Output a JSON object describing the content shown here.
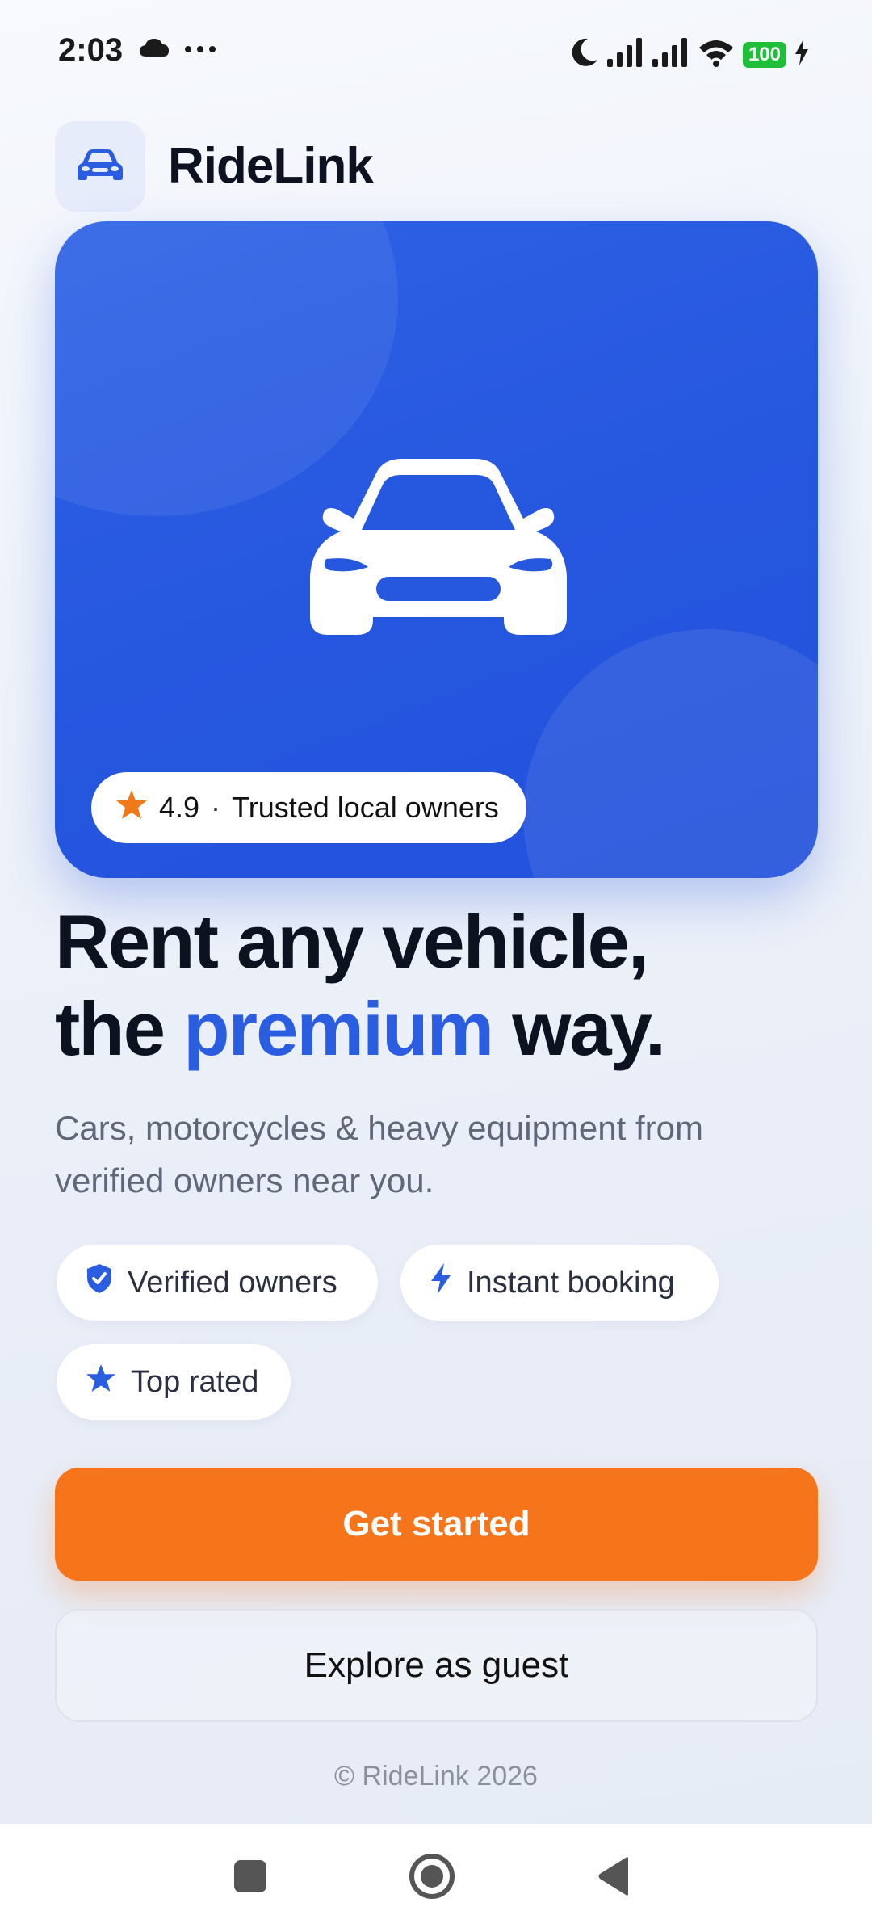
{
  "status_bar": {
    "time": "2:03",
    "battery": "100",
    "icons": [
      "cloud-icon",
      "more-dots-icon",
      "moon-icon",
      "signal-icon",
      "signal-icon",
      "wifi-icon",
      "battery-icon",
      "charging-icon"
    ]
  },
  "header": {
    "app_name": "RideLink",
    "logo_icon": "car-icon"
  },
  "hero": {
    "icon": "car-icon",
    "rating": "4.9",
    "separator": "·",
    "rating_label": "Trusted local owners",
    "rating_icon": "star-icon"
  },
  "headline": {
    "line1": "Rent any vehicle,",
    "line2_prefix": "the ",
    "line2_accent": "premium",
    "line2_suffix": " way."
  },
  "subtitle": "Cars, motorcycles & heavy equipment from verified owners near you.",
  "chips": [
    {
      "label": "Verified owners",
      "icon": "shield-check-icon"
    },
    {
      "label": "Instant booking",
      "icon": "lightning-icon"
    },
    {
      "label": "Top rated",
      "icon": "star-icon"
    }
  ],
  "actions": {
    "primary_label": "Get started",
    "secondary_label": "Explore as guest"
  },
  "footer": {
    "copyright": "© RideLink 2026"
  },
  "colors": {
    "brand_blue": "#2a5de0",
    "accent_orange": "#f6741a",
    "star_orange": "#f07a1a"
  }
}
